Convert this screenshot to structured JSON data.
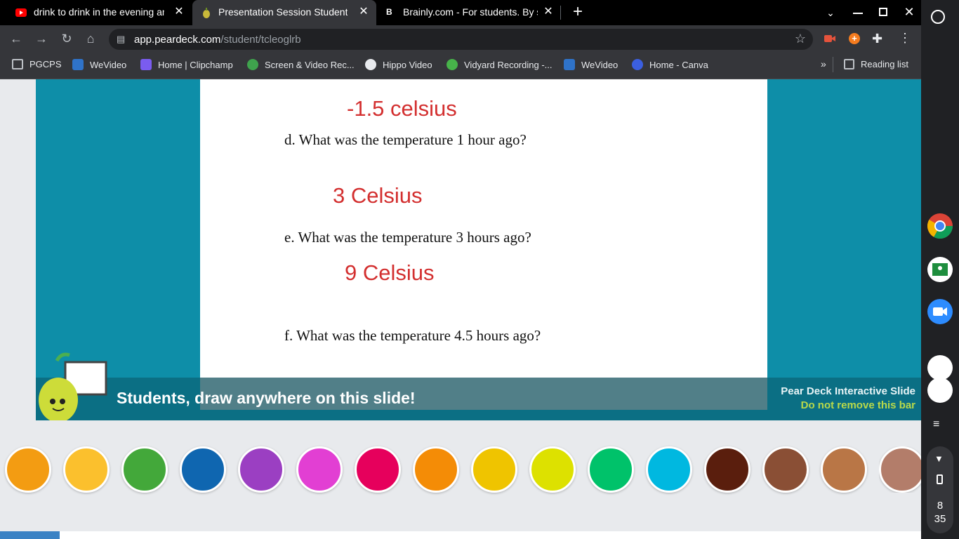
{
  "tabs": [
    {
      "title": "drink to drink in the evening and l",
      "icon": "youtube-icon",
      "active": false
    },
    {
      "title": "Presentation Session Student",
      "icon": "peardeck-icon",
      "active": true
    },
    {
      "title": "Brainly.com - For students. By stu",
      "icon": "brainly-icon",
      "active": false
    }
  ],
  "toolbar": {
    "url_host": "app.peardeck.com",
    "url_path": "/student/tcleoglrb"
  },
  "bookmarks": [
    {
      "label": "PGCPS",
      "icon": "folder-icon"
    },
    {
      "label": "WeVideo",
      "icon": "wevideo-icon"
    },
    {
      "label": "Home | Clipchamp",
      "icon": "clipchamp-icon"
    },
    {
      "label": "Screen & Video Rec...",
      "icon": "screencastify-icon"
    },
    {
      "label": "Hippo Video",
      "icon": "hippo-video-icon"
    },
    {
      "label": "Vidyard Recording -...",
      "icon": "vidyard-icon"
    },
    {
      "label": "WeVideo",
      "icon": "wevideo-icon"
    },
    {
      "label": "Home - Canva",
      "icon": "canva-icon"
    }
  ],
  "reading_list": "Reading list",
  "slide": {
    "answer_c": "-1.5 celsius",
    "question_d": "d.  What was the temperature 1 hour ago?",
    "answer_d": "3 Celsius",
    "question_e": "e.  What was the temperature 3 hours ago?",
    "answer_e": "9 Celsius",
    "question_f": "f.  What was the temperature 4.5 hours ago?"
  },
  "peardeck_bar": {
    "prompt": "Students, draw anywhere on this slide!",
    "label": "Pear Deck Interactive Slide",
    "warning": "Do not remove this bar"
  },
  "palette": [
    "#f39c12",
    "#fbc02d",
    "#43a83a",
    "#0f66b0",
    "#9b3fc2",
    "#e23fd3",
    "#e6005c",
    "#f48c06",
    "#efc400",
    "#dde100",
    "#00c26a",
    "#00b8e0",
    "#5a1e0d",
    "#8a4f35",
    "#b97646",
    "#b37d6a"
  ],
  "clock": {
    "hour": "8",
    "minute": "35"
  },
  "colors": {
    "accent": "#0e8ea8",
    "answer": "#d32f2f"
  }
}
